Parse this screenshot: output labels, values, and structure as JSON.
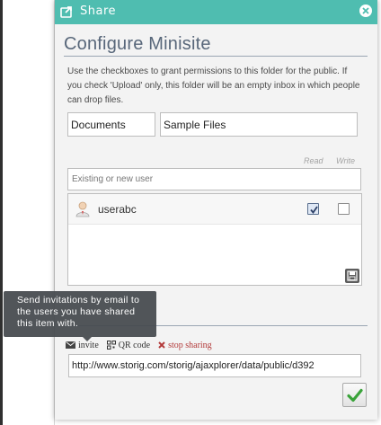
{
  "dialog": {
    "title": "Share",
    "heading": "Configure Minisite",
    "description": "Use the checkboxes to grant permissions to this folder for the public. If you check 'Upload' only, this folder will be an empty inbox in which people can drop files."
  },
  "form": {
    "folder_value": "Documents",
    "label_value": "Sample Files",
    "user_search_placeholder": "Existing or new user",
    "perm_headers": {
      "read": "Read",
      "write": "Write"
    }
  },
  "users": [
    {
      "name": "userabc",
      "read": true,
      "write": false
    }
  ],
  "actions": {
    "invite": "invite",
    "qr_code": "QR code",
    "stop_sharing": "stop sharing"
  },
  "share_url": "http://www.storig.com/storig/ajaxplorer/data/public/d392",
  "tooltip": "Send invitations by email to the users you have shared this item with.",
  "colors": {
    "titlebar": "#4fbdb0",
    "heading": "#58677a",
    "stop_sharing": "#b33a3a",
    "ok_check": "#3aa33a"
  },
  "icons": {
    "title": "share-icon",
    "close": "close-icon",
    "user": "user-icon",
    "save": "save-icon",
    "invite": "envelope-icon",
    "qr": "qr-code-icon",
    "stop": "x-icon",
    "ok": "checkmark-icon"
  }
}
